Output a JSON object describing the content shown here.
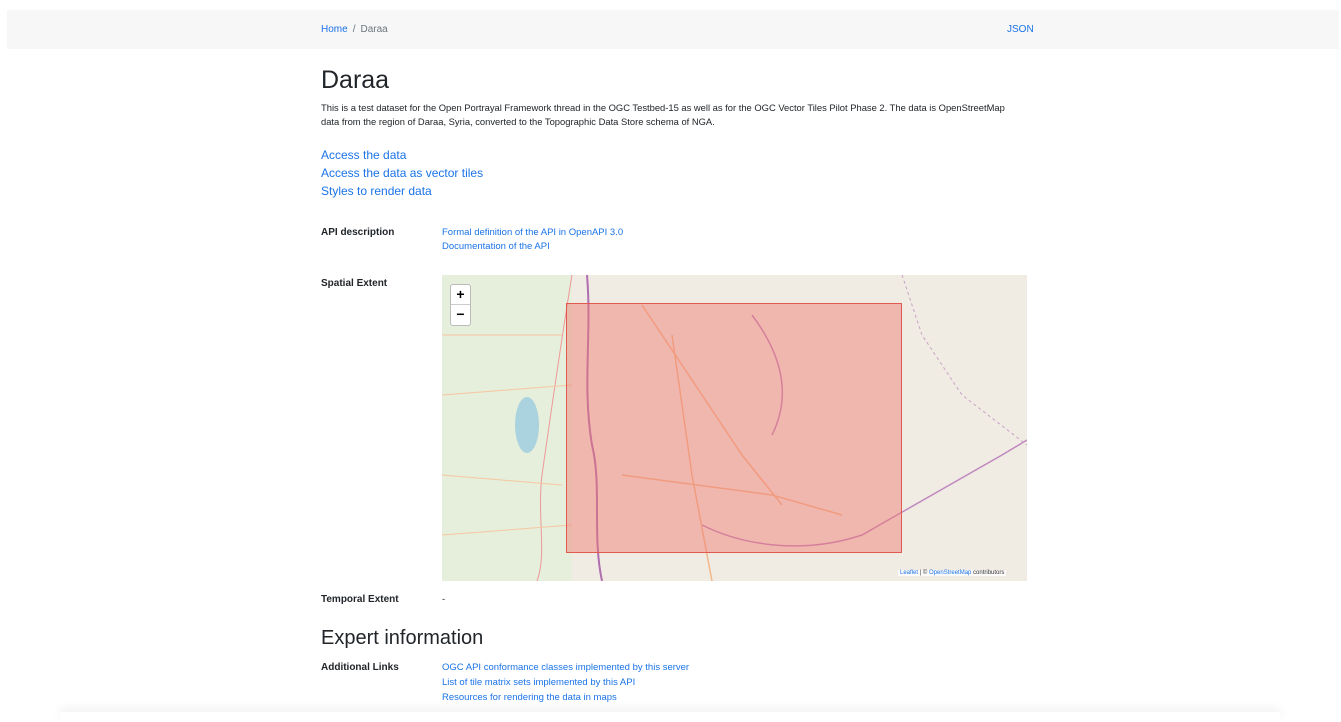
{
  "breadcrumb": {
    "home": "Home",
    "separator": "/",
    "current": "Daraa"
  },
  "json_link": "JSON",
  "title": "Daraa",
  "description": "This is a test dataset for the Open Portrayal Framework thread in the OGC Testbed-15 as well as for the OGC Vector Tiles Pilot Phase 2. The data is OpenStreetMap data from the region of Daraa, Syria, converted to the Topographic Data Store schema of NGA.",
  "links": [
    "Access the data",
    "Access the data as vector tiles",
    "Styles to render data"
  ],
  "api": {
    "label": "API description",
    "links": [
      "Formal definition of the API in OpenAPI 3.0",
      "Documentation of the API"
    ]
  },
  "spatial": {
    "label": "Spatial Extent",
    "zoom_in": "+",
    "zoom_out": "−",
    "attribution": {
      "leaflet": "Leaflet",
      "sep": "| ©",
      "osm": "OpenStreetMap",
      "suffix": "contributors"
    }
  },
  "temporal": {
    "label": "Temporal Extent",
    "value": "-"
  },
  "expert": {
    "title": "Expert information",
    "label": "Additional Links",
    "links": [
      "OGC API conformance classes implemented by this server",
      "List of tile matrix sets implemented by this API",
      "Resources for rendering the data in maps"
    ]
  }
}
